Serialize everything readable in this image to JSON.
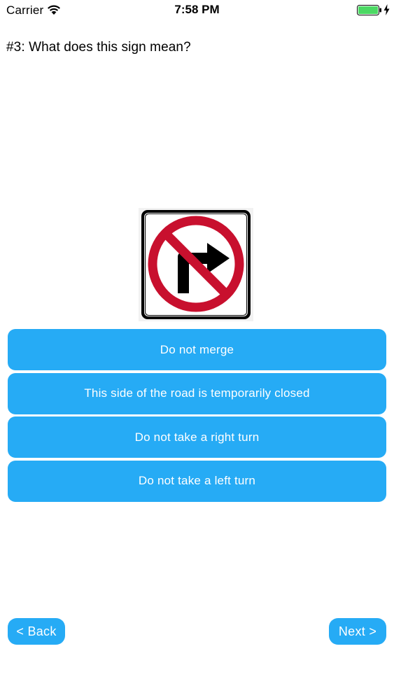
{
  "status_bar": {
    "carrier": "Carrier",
    "time": "7:58 PM",
    "icons": [
      "wifi-icon",
      "battery-icon",
      "charging-bolt-icon"
    ]
  },
  "question": {
    "text": "#3: What does this sign mean?"
  },
  "sign_image": {
    "description_icon": "no-right-turn-sign-icon",
    "colors": {
      "ring": "#c8102e",
      "arrow": "#000000",
      "background": "#ffffff"
    }
  },
  "answers": [
    {
      "label": "Do not merge"
    },
    {
      "label": "This side of the road is temporarily closed"
    },
    {
      "label": "Do not take a right turn"
    },
    {
      "label": "Do not take a left turn"
    }
  ],
  "navigation": {
    "back_label": "< Back",
    "next_label": "Next >"
  },
  "colors": {
    "accent": "#26abf5",
    "button_text": "#ffffff",
    "battery_fill": "#4cd964"
  }
}
